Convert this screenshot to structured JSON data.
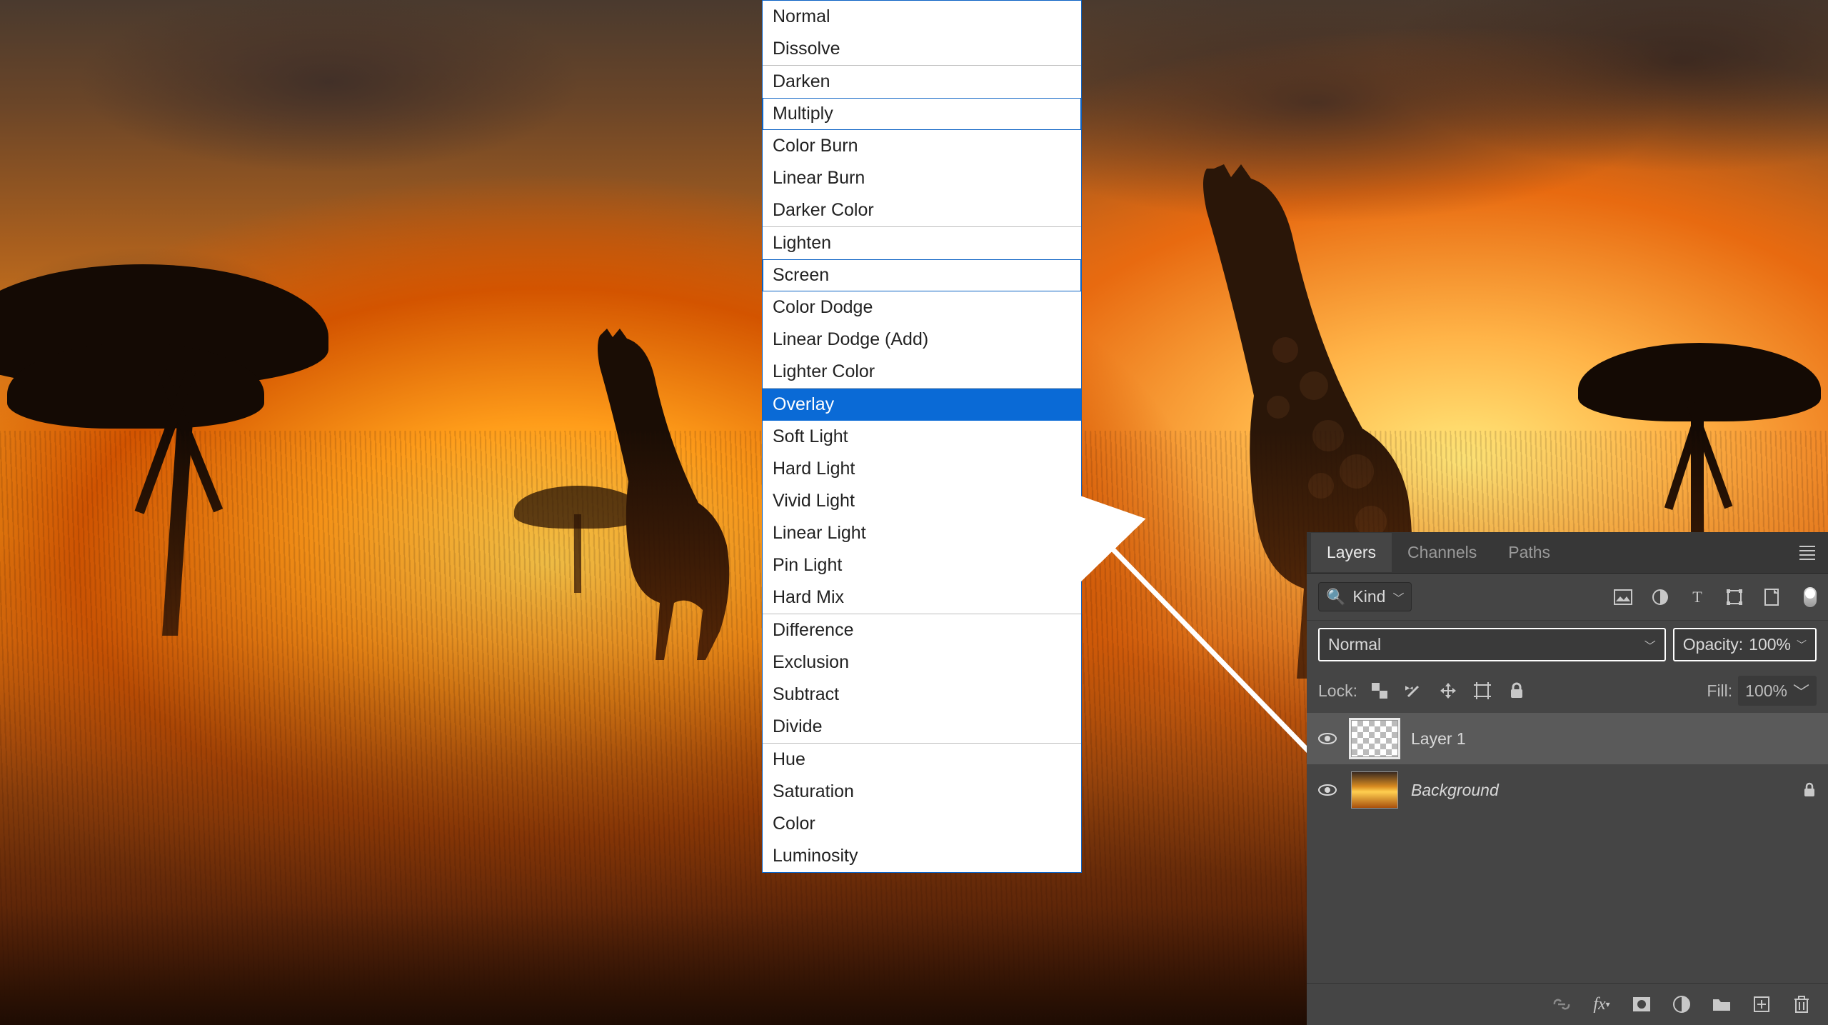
{
  "blend_modes": {
    "groups": [
      {
        "items": [
          {
            "label": "Normal",
            "boxed": false,
            "selected": false
          },
          {
            "label": "Dissolve",
            "boxed": false,
            "selected": false
          }
        ]
      },
      {
        "items": [
          {
            "label": "Darken",
            "boxed": false,
            "selected": false
          },
          {
            "label": "Multiply",
            "boxed": true,
            "selected": false
          },
          {
            "label": "Color Burn",
            "boxed": false,
            "selected": false
          },
          {
            "label": "Linear Burn",
            "boxed": false,
            "selected": false
          },
          {
            "label": "Darker Color",
            "boxed": false,
            "selected": false
          }
        ]
      },
      {
        "items": [
          {
            "label": "Lighten",
            "boxed": false,
            "selected": false
          },
          {
            "label": "Screen",
            "boxed": true,
            "selected": false
          },
          {
            "label": "Color Dodge",
            "boxed": false,
            "selected": false
          },
          {
            "label": "Linear Dodge (Add)",
            "boxed": false,
            "selected": false
          },
          {
            "label": "Lighter Color",
            "boxed": false,
            "selected": false
          }
        ]
      },
      {
        "items": [
          {
            "label": "Overlay",
            "boxed": false,
            "selected": true
          },
          {
            "label": "Soft Light",
            "boxed": false,
            "selected": false
          },
          {
            "label": "Hard Light",
            "boxed": false,
            "selected": false
          },
          {
            "label": "Vivid Light",
            "boxed": false,
            "selected": false
          },
          {
            "label": "Linear Light",
            "boxed": false,
            "selected": false
          },
          {
            "label": "Pin Light",
            "boxed": false,
            "selected": false
          },
          {
            "label": "Hard Mix",
            "boxed": false,
            "selected": false
          }
        ]
      },
      {
        "items": [
          {
            "label": "Difference",
            "boxed": false,
            "selected": false
          },
          {
            "label": "Exclusion",
            "boxed": false,
            "selected": false
          },
          {
            "label": "Subtract",
            "boxed": false,
            "selected": false
          },
          {
            "label": "Divide",
            "boxed": false,
            "selected": false
          }
        ]
      },
      {
        "items": [
          {
            "label": "Hue",
            "boxed": false,
            "selected": false
          },
          {
            "label": "Saturation",
            "boxed": false,
            "selected": false
          },
          {
            "label": "Color",
            "boxed": false,
            "selected": false
          },
          {
            "label": "Luminosity",
            "boxed": false,
            "selected": false
          }
        ]
      }
    ]
  },
  "layers_panel": {
    "tabs": {
      "layers": "Layers",
      "channels": "Channels",
      "paths": "Paths"
    },
    "filter": {
      "kind_label": "Kind"
    },
    "mode": {
      "current": "Normal",
      "opacity_label": "Opacity:",
      "opacity_value": "100%"
    },
    "lock": {
      "label": "Lock:",
      "fill_label": "Fill:",
      "fill_value": "100%"
    },
    "layers": [
      {
        "name": "Layer 1",
        "locked": false,
        "selected": true,
        "italic": false,
        "thumb": "transparent"
      },
      {
        "name": "Background",
        "locked": true,
        "selected": false,
        "italic": true,
        "thumb": "image"
      }
    ]
  }
}
